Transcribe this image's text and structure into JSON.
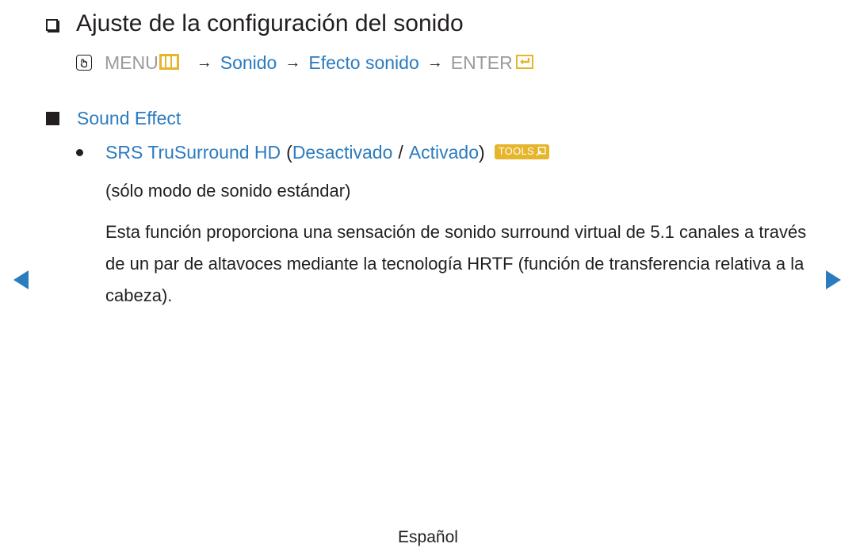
{
  "heading": {
    "title": "Ajuste de la configuración del sonido",
    "checkbox_icon": "checkbox-icon"
  },
  "path": {
    "hand_icon": "hand-pointer-icon",
    "menu_label": "MENU",
    "menu_icon": "menu-grid-icon",
    "arrow": "→",
    "steps": [
      "Sonido",
      "Efecto sonido"
    ],
    "enter_label": "ENTER",
    "enter_icon": "enter-return-icon"
  },
  "section": {
    "label": "Sound Effect"
  },
  "option": {
    "name": "SRS TruSurround HD",
    "open_paren": "(",
    "values": [
      "Desactivado",
      "Activado"
    ],
    "separator": "/",
    "close_paren": ")",
    "tools_label": "TOOLS"
  },
  "note": "(sólo modo de sonido estándar)",
  "description": "Esta función proporciona una sensación de sonido surround virtual de 5.1 canales a través de un par de altavoces mediante la tecnología HRTF (función de transferencia relativa a la cabeza).",
  "navigation": {
    "prev_icon": "previous-page-arrow",
    "next_icon": "next-page-arrow"
  },
  "footer": {
    "language": "Español"
  },
  "colors": {
    "link_blue": "#2b7bbf",
    "accent_yellow": "#e6b52c",
    "menu_grey": "#9b9b9b",
    "text": "#231f20"
  }
}
